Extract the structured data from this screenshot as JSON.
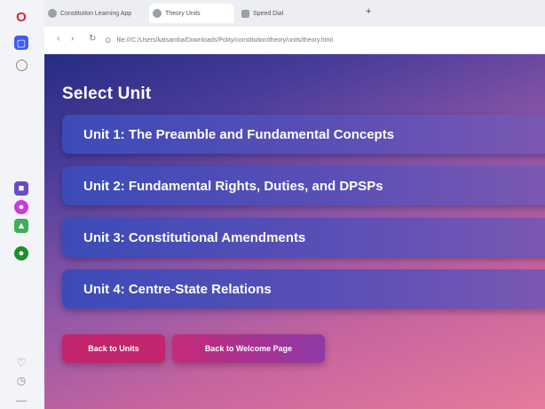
{
  "browser": {
    "tabs": [
      {
        "label": "Constitution Learning App"
      },
      {
        "label": "Theory Units"
      },
      {
        "label": "Speed Dial"
      }
    ],
    "new_tab_label": "+",
    "url": "file:///C:/Users/katsamba/Downloads/Polity/constitution/theory/units/theory.html"
  },
  "page": {
    "title": "Select Unit",
    "units": [
      {
        "label": "Unit 1: The Preamble and Fundamental Concepts"
      },
      {
        "label": "Unit 2: Fundamental Rights, Duties, and DPSPs"
      },
      {
        "label": "Unit 3: Constitutional Amendments"
      },
      {
        "label": "Unit 4: Centre-State Relations"
      }
    ],
    "back_to_units": "Back to Units",
    "back_to_welcome": "Back to Welcome Page"
  }
}
